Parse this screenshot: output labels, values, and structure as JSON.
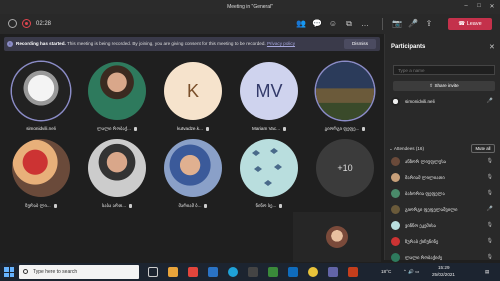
{
  "window": {
    "title": "Meeting in \"General\""
  },
  "toolbar": {
    "timer": "02:28",
    "leave_label": "Leave"
  },
  "banner": {
    "bold": "Recording has started.",
    "text": "This meeting is being recorded. By joining, you are giving consent for this meeting to be recorded.",
    "link": "Privacy policy",
    "dismiss": "Dismiss"
  },
  "tiles": [
    {
      "name": "simonidvili.neli",
      "initials": "",
      "ring": true
    },
    {
      "name": "ლალი რობაქ...",
      "initials": ""
    },
    {
      "name": "kutvadze.k...",
      "initials": "K",
      "bg": "#f6e3cc",
      "fg": "#7a4f2a"
    },
    {
      "name": "Mariam Vac...",
      "initials": "MV",
      "bg": "#cfd3ee",
      "fg": "#333a6a"
    },
    {
      "name": "გიორგი ფეფე...",
      "initials": "",
      "ring": true
    },
    {
      "name": "ზურაბ ლი...",
      "initials": ""
    },
    {
      "name": "საბა ართ...",
      "initials": ""
    },
    {
      "name": "მარიამ ბ...",
      "initials": ""
    },
    {
      "name": "ნინო სე...",
      "initials": ""
    },
    {
      "name": "",
      "initials": "+10",
      "bg": "#3b3b3b",
      "fg": "#ddd"
    }
  ],
  "panel": {
    "title": "Participants",
    "invite_placeholder": "Type a name",
    "share_invite": "Share invite",
    "organizer": "simonidvili.neli",
    "attendees_label": "Attendees (16)",
    "mute_all": "Mute all",
    "attendees": [
      "ანზორ ლიუფლუსა",
      "მარიამ ლილიათი",
      "ბახორია ფეფელა",
      "გიორგი ფეფელაშვილი",
      "ვინნო ეკემისა",
      "ზურაბ ქიჩუნინე",
      "ლალი რობაქიძე",
      "მარიამ ბრეკიძე"
    ]
  },
  "taskbar": {
    "search_placeholder": "Type here to search",
    "temperature": "18°C",
    "time": "15:29",
    "date": "25/02/2021"
  }
}
